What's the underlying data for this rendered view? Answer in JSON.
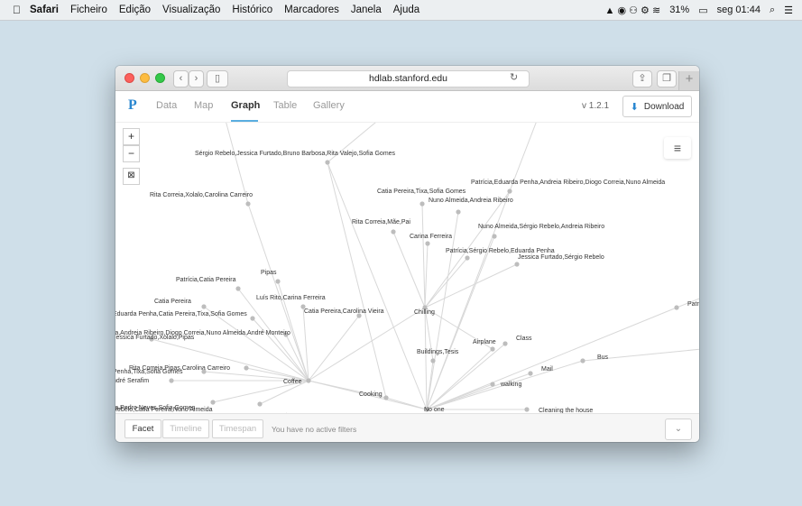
{
  "menubar": {
    "app": "Safari",
    "items": [
      "Ficheiro",
      "Edição",
      "Visualização",
      "Histórico",
      "Marcadores",
      "Janela",
      "Ajuda"
    ],
    "battery": "31%",
    "clock": "seg 01:44"
  },
  "browser": {
    "url": "hdlab.stanford.edu"
  },
  "nav": {
    "logo": "P",
    "tabs": [
      "Data",
      "Map",
      "Graph",
      "Table",
      "Gallery"
    ],
    "active_tab": "Graph",
    "version": "v 1.2.1",
    "download_label": "Download"
  },
  "graph": {
    "zoom_in": "+",
    "zoom_out": "−",
    "nodes": [
      {
        "label": "Sérgio Rebelo,Jessica Furtado,Bruno Barbosa,Rita Valejo,Sofia Gomes"
      },
      {
        "label": "Patrícia,Eduarda Penha,Andreia Ribeiro,Diogo Correia,Nuno Almeida"
      },
      {
        "label": "Rita Correia,Xolalo,Carolina Carreiro"
      },
      {
        "label": "Catia Pereira,Tixa,Sofia Gomes"
      },
      {
        "label": "Nuno Almeida,Andreia Ribeiro"
      },
      {
        "label": "Rita Correia,Mãe,Pai"
      },
      {
        "label": "Nuno Almeida,Sérgio Rebelo,Andreia Ribeiro"
      },
      {
        "label": "Carina Ferreira"
      },
      {
        "label": "Patrícia,Sérgio Rebelo,Eduarda Penha"
      },
      {
        "label": "Jessica Furtado,Sérgio Rebelo"
      },
      {
        "label": "Pipas"
      },
      {
        "label": "Patrícia,Catia Pereira"
      },
      {
        "label": "Luís Rito,Carina Ferreira"
      },
      {
        "label": "Catia Pereira"
      },
      {
        "label": "Catia Pereira,Carolina Vieira"
      },
      {
        "label": "Chilling"
      },
      {
        "label": "Patri"
      },
      {
        "label": "Eduarda Penha,Catia Pereira,Tixa,Sofia Gomes"
      },
      {
        "label": "ra,Andreia Ribeiro,Diogo Correia,Nuno Almeida,André Monteiro"
      },
      {
        "label": "Jessica Furtado,Xolalo,Pipas"
      },
      {
        "label": "Airplane"
      },
      {
        "label": "Class"
      },
      {
        "label": "Buildings,Tesis"
      },
      {
        "label": "Bus"
      },
      {
        "label": "Rita Correia,Pipas,Carolina Carreiro"
      },
      {
        "label": "Penha,Tixa,Sofia Gomes"
      },
      {
        "label": "Mail"
      },
      {
        "label": "ndré Serafim"
      },
      {
        "label": "Coffee"
      },
      {
        "label": "walking"
      },
      {
        "label": "Cooking"
      },
      {
        "label": "ra,Pedro Neves,Sofia Gomes"
      },
      {
        "label": "Rebelo,Catia Pereira,Nuno Almeida"
      },
      {
        "label": "No one"
      },
      {
        "label": "Cleaning the house"
      }
    ]
  },
  "footer": {
    "facet": "Facet",
    "timeline": "Timeline",
    "timespan": "Timespan",
    "filter_status": "You have no active filters"
  }
}
